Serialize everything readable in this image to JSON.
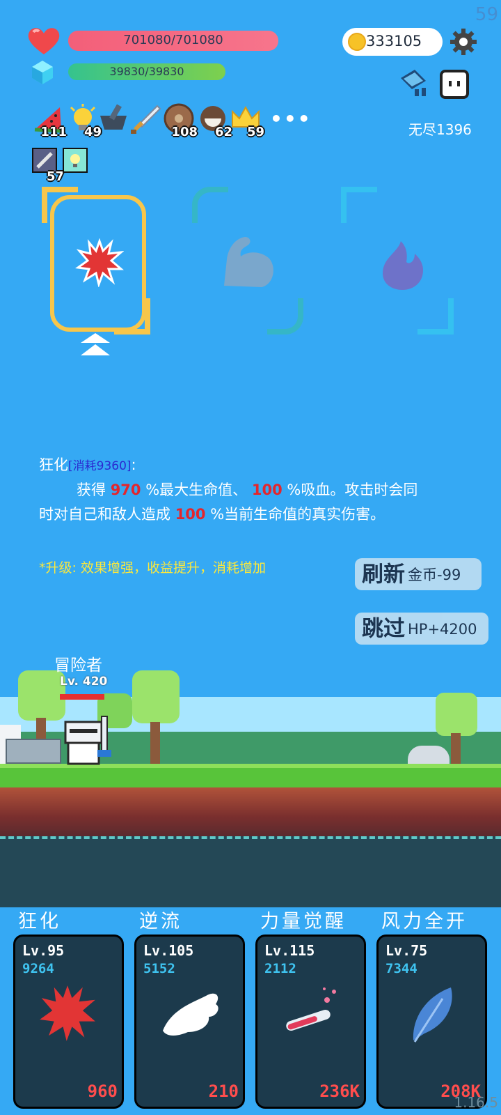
{
  "fps": "59",
  "hp": {
    "text": "701080/701080"
  },
  "mp": {
    "text": "39830/39830"
  },
  "coins": "333105",
  "mode_label": "无尽1396",
  "inventory": [
    {
      "icon": "watermelon-icon",
      "count": "111"
    },
    {
      "icon": "lightbulb-icon",
      "count": "49"
    },
    {
      "icon": "mortar-icon",
      "count": ""
    },
    {
      "icon": "sword-icon",
      "count": ""
    },
    {
      "icon": "shield-icon",
      "count": "108"
    },
    {
      "icon": "coconut-icon",
      "count": "62"
    },
    {
      "icon": "crown-icon",
      "count": "59"
    },
    {
      "icon": "sword-card-icon",
      "count": "57"
    },
    {
      "icon": "bulb-card-icon",
      "count": ""
    }
  ],
  "more_label": "•••",
  "choices": [
    {
      "icon": "splat-icon",
      "selected": true
    },
    {
      "icon": "muscle-icon",
      "selected": false
    },
    {
      "icon": "flame-icon",
      "selected": false
    }
  ],
  "description": {
    "name": "狂化",
    "cost_label": "[消耗9360]",
    "colon": ":",
    "p1": "获得",
    "v1": "970",
    "p2": "%最大生命值、",
    "v2": "100",
    "p3": "%吸血。攻击时会同",
    "p4": "时对自己和敌人造成",
    "v3": "100",
    "p5": "%当前生命值的真实伤害。"
  },
  "tip": "*升级: 效果增强，收益提升，消耗增加",
  "refresh_button": {
    "main": "刷新",
    "sub": "金币-99"
  },
  "skip_button": {
    "main": "跳过",
    "sub": "HP+4200"
  },
  "hero": {
    "name": "冒险者",
    "level": "Lv. 420"
  },
  "skills": [
    {
      "title": "狂化",
      "level": "Lv.95",
      "cost": "9264",
      "price": "960",
      "icon": "splat-icon"
    },
    {
      "title": "逆流",
      "level": "Lv.105",
      "cost": "5152",
      "price": "210",
      "icon": "wing-icon"
    },
    {
      "title": "力量觉醒",
      "level": "Lv.115",
      "cost": "2112",
      "price": "236K",
      "icon": "potion-icon"
    },
    {
      "title": "风力全开",
      "level": "Lv.75",
      "cost": "7344",
      "price": "208K",
      "icon": "feather-icon"
    }
  ],
  "version": "1.16.5",
  "colors": {
    "background": "#35a9f4",
    "hp": "#f35f79",
    "mp": "#7ed04d",
    "highlight": "#f7c64b",
    "damage": "#e3262d"
  }
}
